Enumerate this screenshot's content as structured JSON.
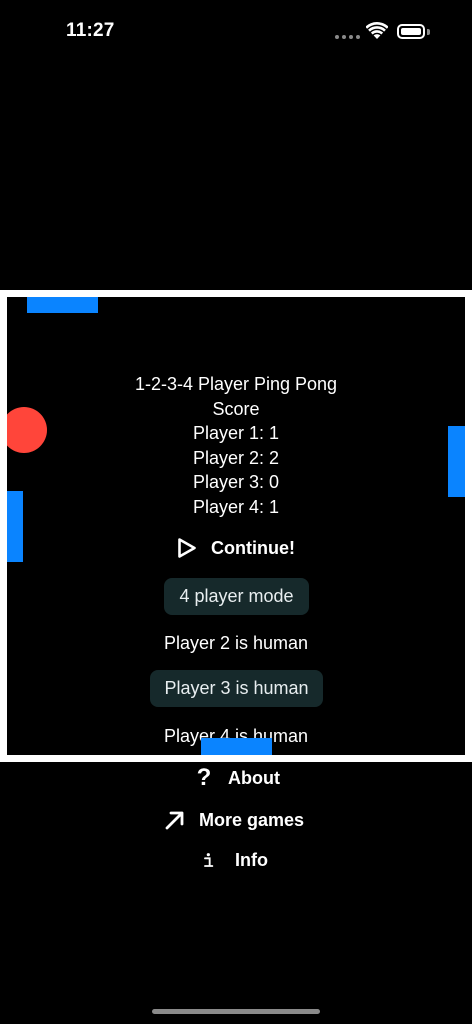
{
  "status_bar": {
    "time": "11:27"
  },
  "game": {
    "title": "1-2-3-4 Player Ping Pong",
    "score_label": "Score",
    "scores": [
      "Player 1: 1",
      "Player 2: 2",
      "Player 3: 0",
      "Player 4: 1"
    ],
    "continue_label": "Continue!",
    "mode_label": "4 player mode",
    "player2_label": "Player 2 is human",
    "player3_label": "Player 3 is human",
    "player4_label": "Player 4 is human"
  },
  "menu": {
    "about_label": "About",
    "more_games_label": "More games",
    "info_label": "Info"
  },
  "colors": {
    "paddle": "#0a84ff",
    "ball": "#ff453a",
    "pill_bg": "#16292b",
    "background": "#000000",
    "frame": "#ffffff"
  },
  "icons": [
    "wifi-icon",
    "battery-icon",
    "play-icon",
    "question-icon",
    "arrow-up-right-icon",
    "info-icon"
  ]
}
